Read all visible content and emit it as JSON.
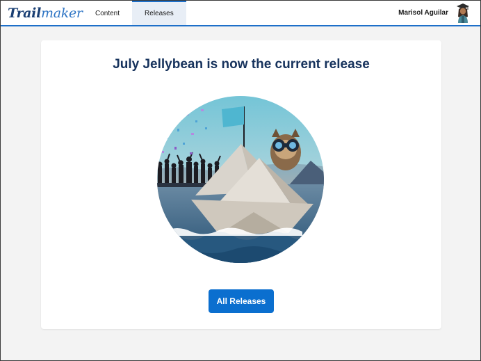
{
  "brand": {
    "part1": "Trail",
    "part2": "maker"
  },
  "nav": {
    "tabs": [
      {
        "label": "Content"
      },
      {
        "label": "Releases",
        "active": true
      }
    ]
  },
  "user": {
    "name": "Marisol Aguilar"
  },
  "main": {
    "headline": "July Jellybean is now the current release",
    "button_label": "All Releases"
  },
  "colors": {
    "accent": "#0b6fcf",
    "headline": "#16325c",
    "nav_border": "#1d6fc9",
    "page_bg": "#f3f3f3"
  }
}
